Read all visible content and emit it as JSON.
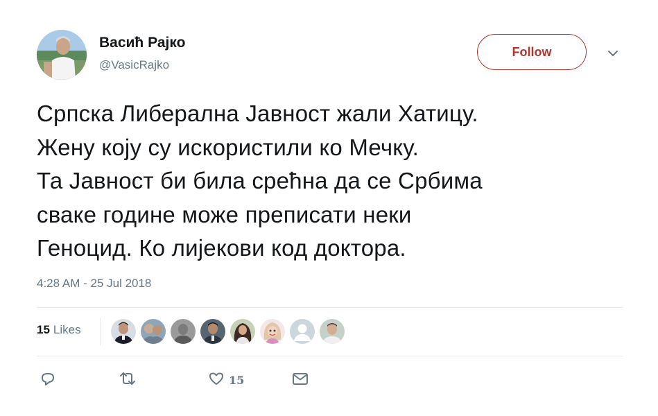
{
  "user": {
    "display_name": "Васић Рајко",
    "handle": "@VasicRajko"
  },
  "follow_button": {
    "label": "Follow",
    "color": "#b0372f"
  },
  "tweet": {
    "lines": [
      "Српска Либерална Јавност жали Хатицу.",
      "Жену коју су искористили ко Мечку.",
      "Та Јавност би била срећна да се Србима",
      "сваке године може преписати неки",
      "Геноцид. Ко лијекови код доктора."
    ],
    "timestamp": "4:28 AM - 25 Jul 2018"
  },
  "stats": {
    "likes_count": "15",
    "likes_label": "Likes"
  },
  "likers": [
    {
      "icon": "avatar"
    },
    {
      "icon": "avatar"
    },
    {
      "icon": "avatar"
    },
    {
      "icon": "avatar"
    },
    {
      "icon": "avatar"
    },
    {
      "icon": "avatar"
    },
    {
      "icon": "default-avatar"
    },
    {
      "icon": "avatar"
    }
  ],
  "actions": {
    "reply_icon": "reply-icon",
    "retweet_icon": "retweet-icon",
    "like_icon": "heart-icon",
    "like_count": "15",
    "dm_icon": "envelope-icon"
  },
  "colors": {
    "text": "#14171a",
    "secondary": "#657786",
    "divider": "#e6ecf0"
  }
}
